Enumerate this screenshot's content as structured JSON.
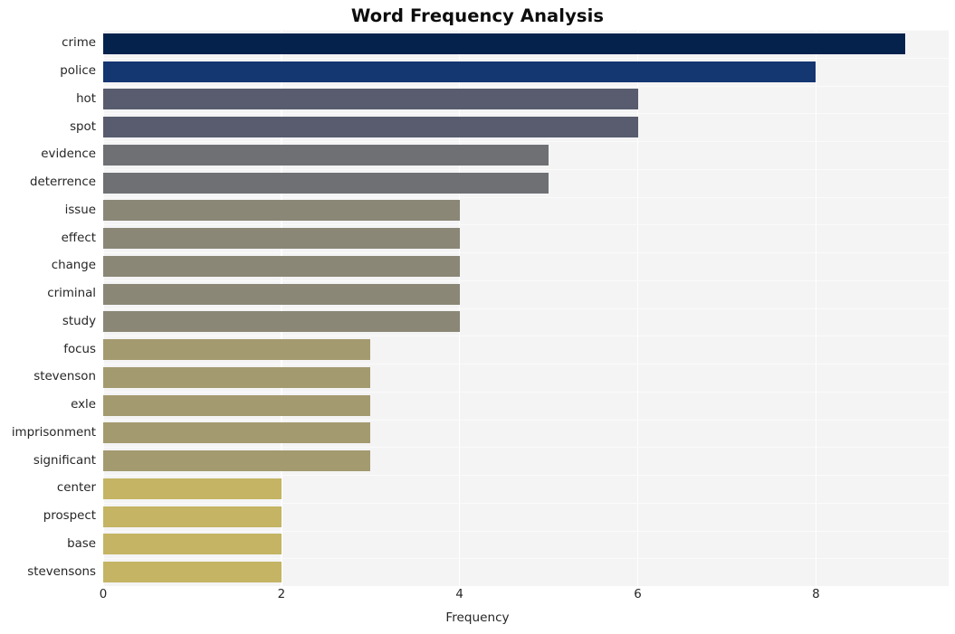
{
  "chart_data": {
    "type": "bar",
    "orientation": "horizontal",
    "title": "Word Frequency Analysis",
    "xlabel": "Frequency",
    "ylabel": "",
    "categories": [
      "crime",
      "police",
      "hot",
      "spot",
      "evidence",
      "deterrence",
      "issue",
      "effect",
      "change",
      "criminal",
      "study",
      "focus",
      "stevenson",
      "exle",
      "imprisonment",
      "significant",
      "center",
      "prospect",
      "base",
      "stevensons"
    ],
    "values": [
      9,
      8,
      6,
      6,
      5,
      5,
      4,
      4,
      4,
      4,
      4,
      3,
      3,
      3,
      3,
      3,
      2,
      2,
      2,
      2
    ],
    "bar_colors": [
      "#05224d",
      "#143671",
      "#585c6e",
      "#585c6e",
      "#6e7074",
      "#6e7074",
      "#8a8777",
      "#8a8777",
      "#8a8777",
      "#8a8777",
      "#8a8777",
      "#a49a6f",
      "#a49a6f",
      "#a49a6f",
      "#a49a6f",
      "#a49a6f",
      "#c4b464",
      "#c4b464",
      "#c4b464",
      "#c4b464"
    ],
    "xticks": [
      0,
      2,
      4,
      6,
      8
    ],
    "xtick_labels": [
      "0",
      "2",
      "4",
      "6",
      "8"
    ],
    "xlim": [
      0,
      9.49
    ],
    "grid": true,
    "grid_color": "#ffffff",
    "plot_background": "#f4f4f5",
    "figure_background": "#ffffff",
    "legend": "none"
  }
}
